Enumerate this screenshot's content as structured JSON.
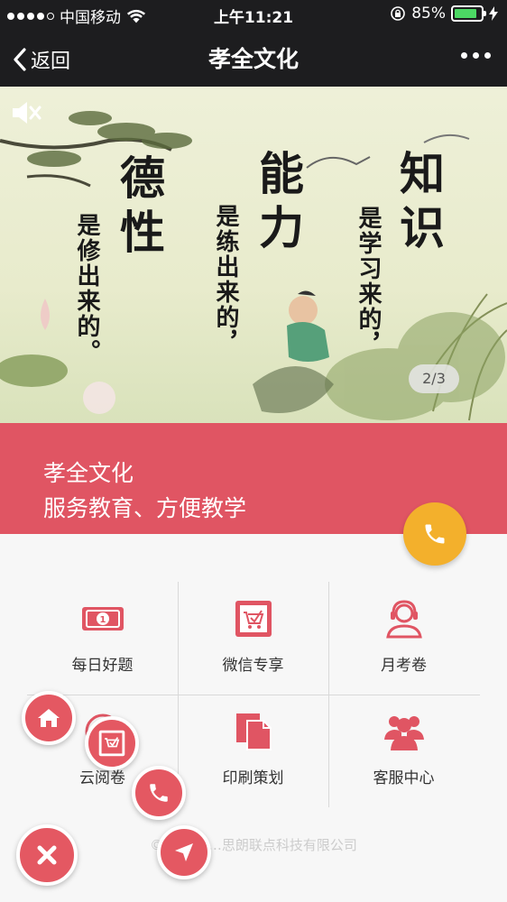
{
  "status_bar": {
    "carrier": "中国移动",
    "time": "上午11:21",
    "battery": "85%"
  },
  "nav": {
    "back_label": "返回",
    "title": "孝全文化"
  },
  "banner": {
    "calligraphy": [
      "德性",
      "是修出来的。",
      "能力",
      "是练出来的，",
      "知识",
      "是学习来的，"
    ],
    "pager": "2/3"
  },
  "hero": {
    "line1": "孝全文化",
    "line2": "服务教育、方便教学"
  },
  "grid": {
    "items": [
      {
        "label": "每日好题",
        "icon": "money-icon"
      },
      {
        "label": "微信专享",
        "icon": "cart-icon"
      },
      {
        "label": "月考卷",
        "icon": "support-agent-icon"
      },
      {
        "label": "云阅卷",
        "icon": "scan-icon"
      },
      {
        "label": "印刷策划",
        "icon": "documents-icon"
      },
      {
        "label": "客服中心",
        "icon": "group-icon"
      }
    ]
  },
  "footer": {
    "text": "© 济南……思朗联点科技有限公司"
  },
  "colors": {
    "brand_red": "#e05563",
    "phone_yellow": "#f3b02c",
    "fab_red": "#e45862"
  }
}
